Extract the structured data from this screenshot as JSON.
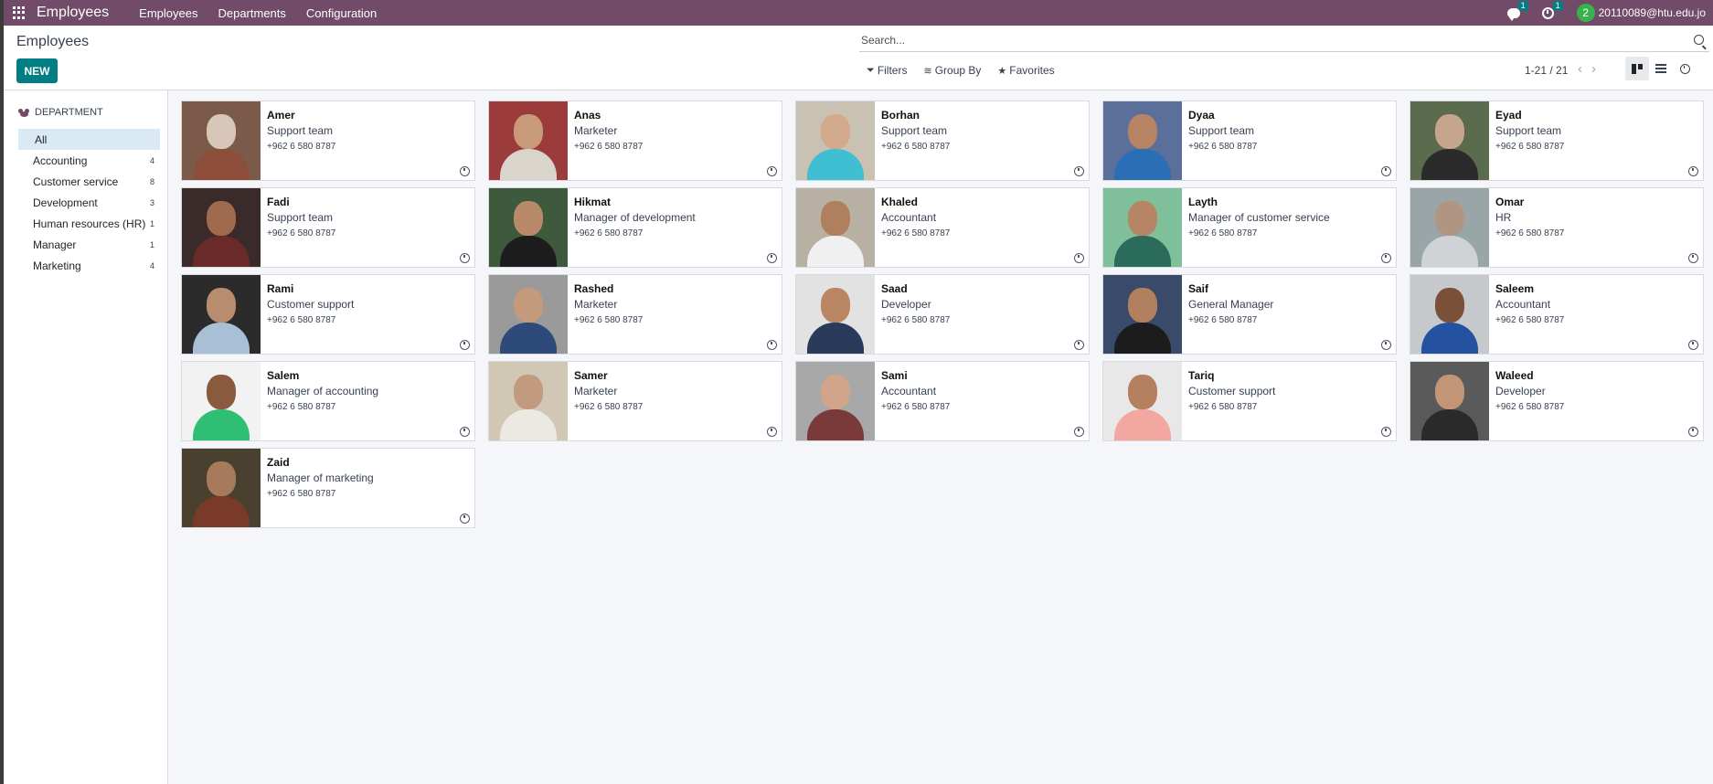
{
  "navbar": {
    "app_title": "Employees",
    "menu": [
      "Employees",
      "Departments",
      "Configuration"
    ],
    "messages_badge": "1",
    "activities_badge": "1",
    "user_initial": "2",
    "user_email": "20110089@htu.edu.jo",
    "color": "#714b67"
  },
  "control_panel": {
    "breadcrumb": "Employees",
    "new_label": "NEW",
    "search_placeholder": "Search...",
    "filters_label": "Filters",
    "groupby_label": "Group By",
    "favorites_label": "Favorites",
    "pager": "1-21 / 21"
  },
  "sidebar": {
    "header": "DEPARTMENT",
    "items": [
      {
        "label": "All",
        "count": ""
      },
      {
        "label": "Accounting",
        "count": "4"
      },
      {
        "label": "Customer service",
        "count": "8"
      },
      {
        "label": "Development",
        "count": "3"
      },
      {
        "label": "Human resources (HR)",
        "count": "1"
      },
      {
        "label": "Manager",
        "count": "1"
      },
      {
        "label": "Marketing",
        "count": "4"
      }
    ]
  },
  "employees": [
    {
      "name": "Amer",
      "job": "Support team",
      "phone": "+962 6 580 8787",
      "bg": "#7b5a4a",
      "skin": "#d8c7b8",
      "shirt": "#8c4e3a"
    },
    {
      "name": "Anas",
      "job": "Marketer",
      "phone": "+962 6 580 8787",
      "bg": "#9c3b3b",
      "skin": "#c99a7a",
      "shirt": "#d9d4cc"
    },
    {
      "name": "Borhan",
      "job": "Support team",
      "phone": "+962 6 580 8787",
      "bg": "#c9c2b3",
      "skin": "#d2a98a",
      "shirt": "#3fbfd1"
    },
    {
      "name": "Dyaa",
      "job": "Support team",
      "phone": "+962 6 580 8787",
      "bg": "#5a6f9a",
      "skin": "#b78463",
      "shirt": "#2a6fb5"
    },
    {
      "name": "Eyad",
      "job": "Support team",
      "phone": "+962 6 580 8787",
      "bg": "#5a6b4e",
      "skin": "#c6a58d",
      "shirt": "#2b2b2b"
    },
    {
      "name": "Fadi",
      "job": "Support team",
      "phone": "+962 6 580 8787",
      "bg": "#3a2a2a",
      "skin": "#a06a4e",
      "shirt": "#6b2a2a"
    },
    {
      "name": "Hikmat",
      "job": "Manager of development",
      "phone": "+962 6 580 8787",
      "bg": "#3e5a3c",
      "skin": "#b88a6a",
      "shirt": "#1d1d1d"
    },
    {
      "name": "Khaled",
      "job": "Accountant",
      "phone": "+962 6 580 8787",
      "bg": "#b8b0a2",
      "skin": "#b0805e",
      "shirt": "#f0f0f0"
    },
    {
      "name": "Layth",
      "job": "Manager of customer service",
      "phone": "+962 6 580 8787",
      "bg": "#7fbf9a",
      "skin": "#b68566",
      "shirt": "#2a6b5a"
    },
    {
      "name": "Omar",
      "job": "HR",
      "phone": "+962 6 580 8787",
      "bg": "#9aa5a8",
      "skin": "#b09582",
      "shirt": "#cfd3d6"
    },
    {
      "name": "Rami",
      "job": "Customer support",
      "phone": "+962 6 580 8787",
      "bg": "#2b2b2b",
      "skin": "#b88c6e",
      "shirt": "#a9bfd6"
    },
    {
      "name": "Rashed",
      "job": "Marketer",
      "phone": "+962 6 580 8787",
      "bg": "#9a9a9a",
      "skin": "#c39a7c",
      "shirt": "#2d4a7a"
    },
    {
      "name": "Saad",
      "job": "Developer",
      "phone": "+962 6 580 8787",
      "bg": "#e2e2e2",
      "skin": "#b98563",
      "shirt": "#2a3a5a"
    },
    {
      "name": "Saif",
      "job": "General Manager",
      "phone": "+962 6 580 8787",
      "bg": "#3a4a6a",
      "skin": "#b0805f",
      "shirt": "#1c1c1c"
    },
    {
      "name": "Saleem",
      "job": "Accountant",
      "phone": "+962 6 580 8787",
      "bg": "#c6c9cc",
      "skin": "#7a5038",
      "shirt": "#2452a0"
    },
    {
      "name": "Salem",
      "job": "Manager of accounting",
      "phone": "+962 6 580 8787",
      "bg": "#f2f2f2",
      "skin": "#8a5a3e",
      "shirt": "#2fbf74"
    },
    {
      "name": "Samer",
      "job": "Marketer",
      "phone": "+962 6 580 8787",
      "bg": "#d0c7b5",
      "skin": "#c29a80",
      "shirt": "#ece8e2"
    },
    {
      "name": "Sami",
      "job": "Accountant",
      "phone": "+962 6 580 8787",
      "bg": "#a8a8a8",
      "skin": "#d1a58a",
      "shirt": "#7a3a3a"
    },
    {
      "name": "Tariq",
      "job": "Customer support",
      "phone": "+962 6 580 8787",
      "bg": "#e8e8e8",
      "skin": "#b5805f",
      "shirt": "#f2a7a0"
    },
    {
      "name": "Waleed",
      "job": "Developer",
      "phone": "+962 6 580 8787",
      "bg": "#5a5a5a",
      "skin": "#c19575",
      "shirt": "#2a2a2a"
    },
    {
      "name": "Zaid",
      "job": "Manager of marketing",
      "phone": "+962 6 580 8787",
      "bg": "#4a4030",
      "skin": "#a87a5c",
      "shirt": "#7a3a2a"
    }
  ]
}
